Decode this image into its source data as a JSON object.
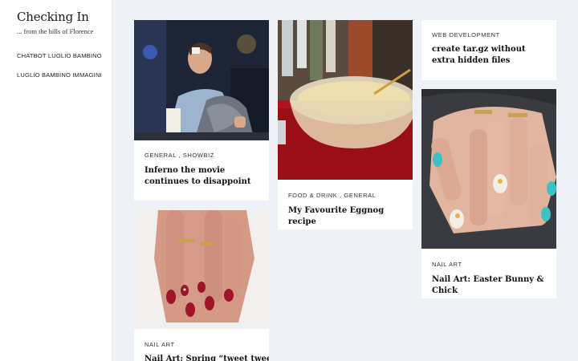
{
  "site": {
    "title": "Checking In",
    "tagline": "... from the hills of Florence"
  },
  "nav": {
    "items": [
      "CHATBOT LUGLIO BAMBINO",
      "LUGLIO BAMBINO IMMAGINI"
    ]
  },
  "posts": [
    {
      "categories": "GENERAL , SHOWBIZ",
      "title": "Inferno the movie continues to disappoint",
      "image": "man-in-blanket-photo"
    },
    {
      "categories": "FOOD & DRINK , GENERAL",
      "title": "My Favourite Eggnog recipe",
      "image": "eggnog-bowl-photo"
    },
    {
      "categories": "WEB DEVELOPMENT",
      "title": "create tar.gz without extra hidden files",
      "image": ""
    },
    {
      "categories": "NAIL ART",
      "title": "Nail Art: Spring “tweet tweet”",
      "image": "red-nails-photo"
    },
    {
      "categories": "NAIL ART",
      "title": "Nail Art: Easter Bunny & Chick",
      "image": "easter-nails-photo"
    }
  ],
  "colors": {
    "background": "#eef1f5",
    "sidebar": "#ffffff",
    "card": "#ffffff",
    "title_text": "#111111"
  }
}
